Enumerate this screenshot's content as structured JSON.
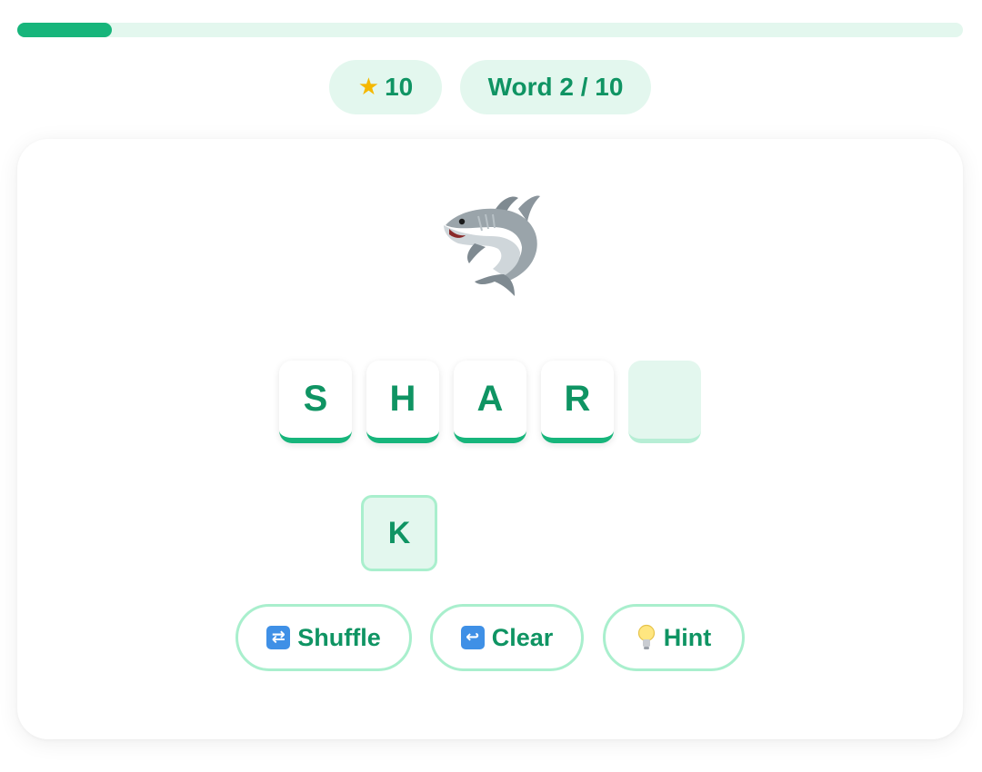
{
  "progress": {
    "fraction": 0.1
  },
  "stats": {
    "score": "10",
    "word_counter": "Word 2 / 10"
  },
  "puzzle": {
    "image_icon": "shark-icon",
    "answer_slots": [
      "S",
      "H",
      "A",
      "R",
      ""
    ],
    "letter_tiles": [
      "K"
    ]
  },
  "controls": {
    "shuffle_label": "Shuffle",
    "clear_label": "Clear",
    "hint_label": "Hint"
  },
  "colors": {
    "accent": "#17b57b",
    "text": "#0f9463",
    "tint": "#e3f7ee",
    "border": "#a9efcd"
  }
}
